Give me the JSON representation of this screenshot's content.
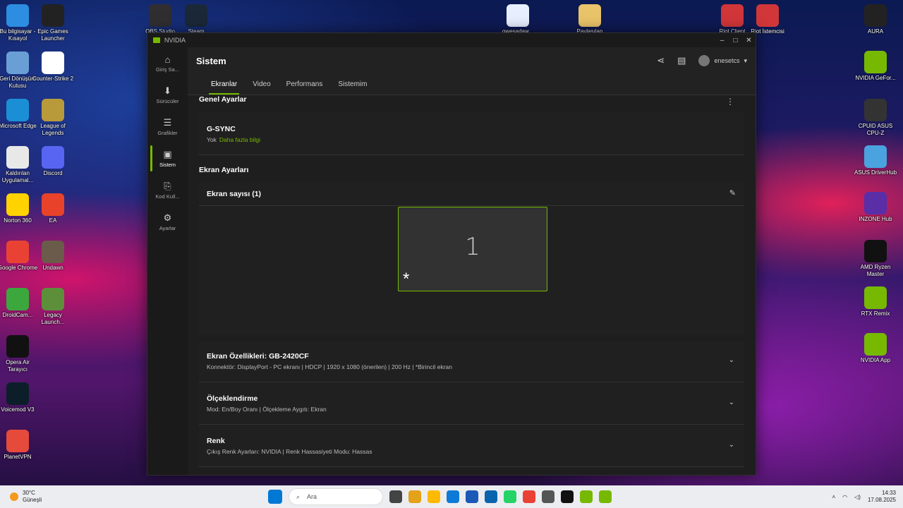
{
  "desktop": {
    "left_icons": [
      {
        "label": "Bu bilgisayar - Kısayol",
        "color": "#2d8de0"
      },
      {
        "label": "Epic Games Launcher",
        "color": "#222222"
      },
      {
        "label": "Geri Dönüşüm Kutusu",
        "color": "#6a9fd6"
      },
      {
        "label": "Counter-Strike 2",
        "color": "#ffffff"
      },
      {
        "label": "Microsoft Edge",
        "color": "#1b8fd6"
      },
      {
        "label": "League of Legends",
        "color": "#b99a3b"
      },
      {
        "label": "Kaldırılan Uygulamal...",
        "color": "#e8e8e8"
      },
      {
        "label": "Discord",
        "color": "#5865f2"
      },
      {
        "label": "Norton 360",
        "color": "#ffd200"
      },
      {
        "label": "EA",
        "color": "#e8432a"
      },
      {
        "label": "Google Chrome",
        "color": "#e94235"
      },
      {
        "label": "Undawn",
        "color": "#6b5b4a"
      },
      {
        "label": "DroidCam...",
        "color": "#3ca73c"
      },
      {
        "label": "Legacy Launch...",
        "color": "#5d8f3a"
      },
      {
        "label": "Opera Air Tarayıcı",
        "color": "#111111"
      },
      {
        "label": "Voicemod V3",
        "color": "#0c1e2a"
      },
      {
        "label": "PlanetVPN",
        "color": "#e64a3b"
      }
    ],
    "top_icons": [
      {
        "label": "OBS Studio",
        "color": "#302e31"
      },
      {
        "label": "Steam",
        "color": "#1b2838"
      },
      {
        "label": "gwesadaw...",
        "color": "#e8f0ff"
      },
      {
        "label": "Paylaşılan",
        "color": "#e9c46a"
      },
      {
        "label": "Riot Client",
        "color": "#d13639"
      },
      {
        "label": "Riot İstemcisi",
        "color": "#d13639"
      }
    ],
    "right_icons": [
      {
        "label": "AURA",
        "color": "#222222"
      },
      {
        "label": "NVIDIA GeFor...",
        "color": "#76b900"
      },
      {
        "label": "CPUID ASUS CPU-Z",
        "color": "#333333"
      },
      {
        "label": "ASUS DriverHub",
        "color": "#4aa3df"
      },
      {
        "label": "INZONE Hub",
        "color": "#5a2ea6"
      },
      {
        "label": "AMD Ryzen Master",
        "color": "#111111"
      },
      {
        "label": "RTX Remix",
        "color": "#76b900"
      },
      {
        "label": "NVIDIA App",
        "color": "#76b900"
      }
    ]
  },
  "window": {
    "app_name": "NVIDIA",
    "controls": {
      "minimize": "–",
      "maximize": "□",
      "close": "✕"
    },
    "sidebar": [
      {
        "label": "Giriş Sa...",
        "icon": "⌂",
        "active": false
      },
      {
        "label": "Sürücüler",
        "icon": "⬇",
        "active": false
      },
      {
        "label": "Grafikler",
        "icon": "☰",
        "active": false
      },
      {
        "label": "Sistem",
        "icon": "▣",
        "active": true
      },
      {
        "label": "Kod Kull...",
        "icon": "⎘",
        "active": false
      },
      {
        "label": "Ayarlar",
        "icon": "⚙",
        "active": false
      }
    ],
    "header": {
      "title": "Sistem",
      "username": "enesetcs"
    },
    "tabs": [
      "Ekranlar",
      "Video",
      "Performans",
      "Sistemim"
    ],
    "active_tab": "Ekranlar",
    "general_settings": {
      "title": "Genel Ayarlar",
      "gsync_title": "G-SYNC",
      "gsync_value": "Yok",
      "gsync_link": "Daha fazla bilgi"
    },
    "display_settings": {
      "title": "Ekran Ayarları",
      "count_label": "Ekran sayısı (1)",
      "display_number": "1",
      "primary_marker": "*"
    },
    "sections": [
      {
        "title": "Ekran Özellikleri: GB-2420CF",
        "subtitle": "Konnektör: DisplayPort - PC ekranı | HDCP | 1920 x 1080 (önerilen) | 200 Hz | *Birincil ekran"
      },
      {
        "title": "Ölçeklendirme",
        "subtitle": "Mod: En/Boy Oranı | Ölçekleme Aygıtı: Ekran"
      },
      {
        "title": "Renk",
        "subtitle": "Çıkış Renk Ayarları: NVIDIA | Renk Hassasiyeti Modu: Hassas"
      }
    ]
  },
  "taskbar": {
    "weather_temp": "30°C",
    "weather_desc": "Güneşli",
    "search_placeholder": "Ara",
    "time": "14:33",
    "date": "17.08.2025",
    "app_colors": [
      "#0078d4",
      "#444444",
      "#e3a21a",
      "#ffb900",
      "#0c7ad6",
      "#1b59b6",
      "#0a64ad",
      "#25d366",
      "#e94235",
      "#555555",
      "#111111",
      "#76b900",
      "#76b900"
    ]
  }
}
